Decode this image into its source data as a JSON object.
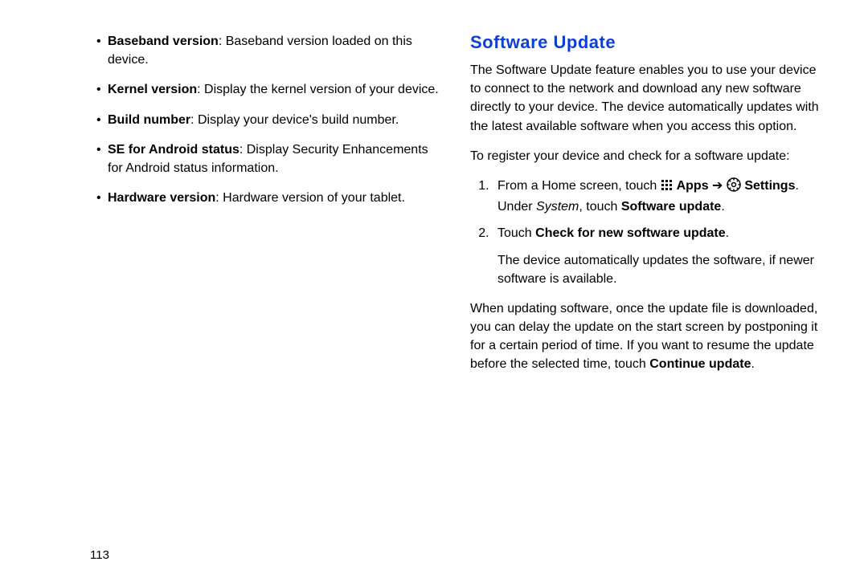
{
  "page_number": "113",
  "left": {
    "bullets": [
      {
        "term": "Baseband version",
        "desc": ": Baseband version loaded on this device."
      },
      {
        "term": "Kernel version",
        "desc": ": Display the kernel version of your device."
      },
      {
        "term": "Build number",
        "desc": ": Display your device's build number."
      },
      {
        "term": "SE for Android status",
        "desc": ": Display Security Enhancements for Android status information."
      },
      {
        "term": "Hardware version",
        "desc": ": Hardware version of your tablet."
      }
    ]
  },
  "right": {
    "heading": "Software Update",
    "para1": "The Software Update feature enables you to use your device to connect to the network and download any new software directly to your device. The device automatically updates with the latest available software when you access this option.",
    "para2": "To register your device and check for a software update:",
    "step1_a": "From a Home screen, touch ",
    "step1_apps": " Apps",
    "step1_arrow": " ➔ ",
    "step1_settings": " Settings",
    "step1_b": ". Under ",
    "step1_system": "System",
    "step1_c": ", touch ",
    "step1_su": "Software update",
    "step1_d": ".",
    "step2_a": "Touch ",
    "step2_bold": "Check for new software update",
    "step2_b": ".",
    "step2_para": "The device automatically updates the software, if newer software is available.",
    "para3_a": "When updating software, once the update file is downloaded, you can delay the update on the start screen by postponing it for a certain period of time. If you want to resume the update before the selected time, touch ",
    "para3_bold": "Continue update",
    "para3_b": "."
  }
}
